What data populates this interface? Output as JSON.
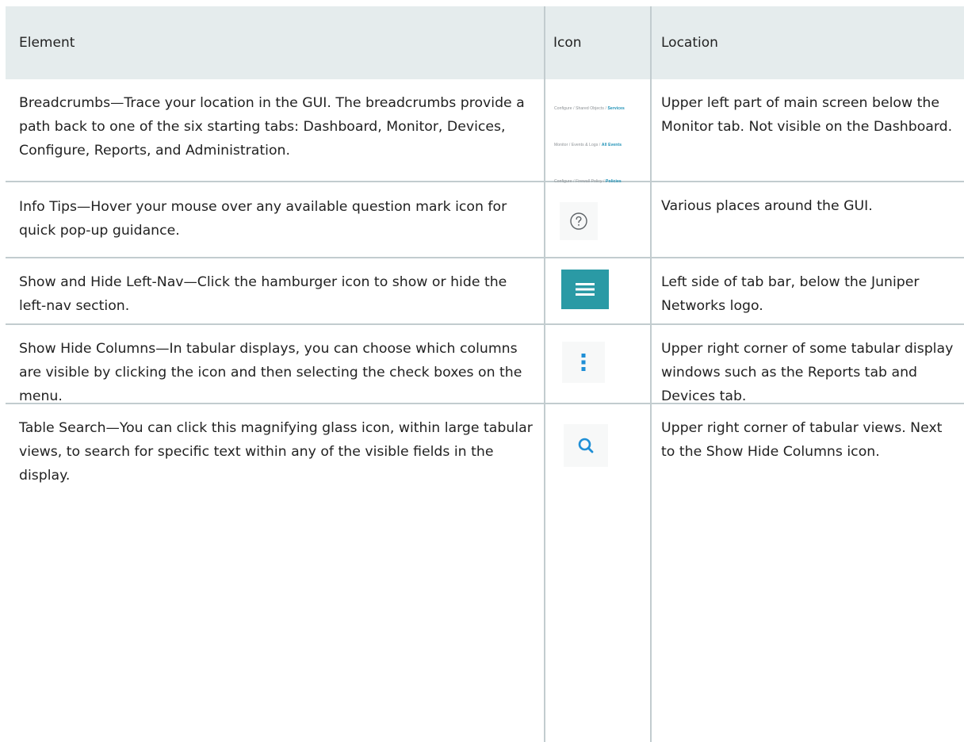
{
  "table": {
    "headers": [
      "Element",
      "Icon",
      "Location"
    ],
    "rows": [
      {
        "element": "Breadcrumbs—Trace your location in the GUI. The breadcrumbs provide a path back to one of the six starting tabs: Dashboard, Monitor, Devices, Configure, Reports, and Administration.",
        "icon": "breadcrumb-examples",
        "location": "Upper left part of main screen below the Monitor tab. Not visible on the Dashboard."
      },
      {
        "element": "Info Tips—Hover your mouse over any available question mark icon for quick pop-up guidance.",
        "icon": "question-circle-icon",
        "location": "Various places around the GUI."
      },
      {
        "element": "Show and Hide Left-Nav—Click the hamburger icon to show or hide the left-nav section.",
        "icon": "hamburger-icon",
        "location": "Left side of tab bar, below the Juniper Networks logo."
      },
      {
        "element": "Show Hide Columns—In tabular displays, you can choose which columns are visible by clicking the icon and then selecting the check boxes on the menu.",
        "icon": "vertical-dots-icon",
        "location": "Upper right corner of some tabular display windows such as the Reports tab and Devices tab."
      },
      {
        "element": "Table Search—You can click this magnifying glass icon, within large tabular views, to search for specific text within any of the visible fields in the display.",
        "icon": "magnifier-icon",
        "location": "Upper right corner of tabular views. Next to the Show Hide Columns icon."
      }
    ]
  },
  "breadcrumbs": [
    {
      "parts": [
        "Configure",
        "Shared Objects"
      ],
      "current": "Services"
    },
    {
      "parts": [
        "Monitor",
        "Events & Logs"
      ],
      "current": "All Events"
    },
    {
      "parts": [
        "Configure",
        "Firewall Policy"
      ],
      "current": "Policies"
    }
  ],
  "breadcrumb_separator": "/",
  "colors": {
    "header_bg": "#e5eced",
    "grid_line": "#c2cccf",
    "hamburger_bg": "#2a9aa5",
    "icon_blue": "#1f8fd6",
    "breadcrumb_current": "#1a8fb5"
  }
}
